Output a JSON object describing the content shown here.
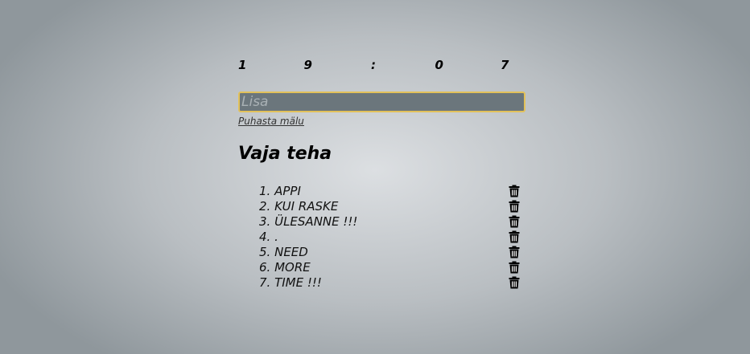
{
  "clock": {
    "digits": [
      "1",
      "9",
      ":",
      "0",
      "7"
    ]
  },
  "add_input": {
    "placeholder": "Lisa",
    "value": ""
  },
  "clear_link": "Puhasta mälu",
  "heading": "Vaja teha",
  "todos": [
    {
      "number": "1.",
      "text": "APPI",
      "icon": "trash-icon"
    },
    {
      "number": "2.",
      "text": "KUI RASKE",
      "icon": "trash-icon"
    },
    {
      "number": "3.",
      "text": "ÜLESANNE !!!",
      "icon": "trash-icon"
    },
    {
      "number": "4.",
      "text": ".",
      "icon": "trash-icon"
    },
    {
      "number": "5.",
      "text": "NEED",
      "icon": "trash-icon"
    },
    {
      "number": "6.",
      "text": "MORE",
      "icon": "trash-icon"
    },
    {
      "number": "7.",
      "text": "TIME !!!",
      "icon": "trash-icon"
    }
  ],
  "colors": {
    "input_background": "#6b767c",
    "input_border": "#e2c15a",
    "text": "#111111"
  }
}
